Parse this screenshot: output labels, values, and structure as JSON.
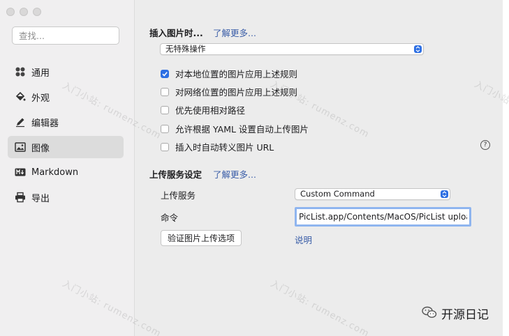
{
  "sidebar": {
    "search_placeholder": "查找...",
    "items": [
      {
        "label": "通用",
        "icon": "grid-icon"
      },
      {
        "label": "外观",
        "icon": "paint-bucket-icon"
      },
      {
        "label": "编辑器",
        "icon": "pencil-icon"
      },
      {
        "label": "图像",
        "icon": "image-icon",
        "active": true
      },
      {
        "label": "Markdown",
        "icon": "markdown-icon"
      },
      {
        "label": "导出",
        "icon": "printer-icon"
      }
    ]
  },
  "insert": {
    "title": "插入图片时...",
    "learn_more": "了解更多...",
    "action_value": "无特殊操作",
    "options": [
      {
        "label": "对本地位置的图片应用上述规则",
        "checked": true
      },
      {
        "label": "对网络位置的图片应用上述规则",
        "checked": false
      },
      {
        "label": "优先使用相对路径",
        "checked": false
      },
      {
        "label": "允许根据 YAML 设置自动上传图片",
        "checked": false
      },
      {
        "label": "插入时自动转义图片 URL",
        "checked": false
      }
    ],
    "help": "?"
  },
  "upload": {
    "title": "上传服务设定",
    "learn_more": "了解更多...",
    "service_label": "上传服务",
    "service_value": "Custom Command",
    "command_label": "命令",
    "command_value": "PicList.app/Contents/MacOS/PicList upload",
    "verify_button": "验证图片上传选项",
    "explain_link": "说明"
  },
  "watermark": "入门小站: rumenz.com",
  "brand": "开源日记",
  "colors": {
    "accent": "#2d6fe3",
    "link": "#3b5ea8"
  }
}
